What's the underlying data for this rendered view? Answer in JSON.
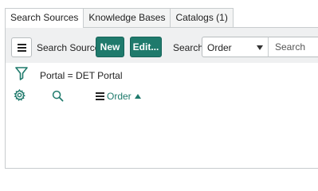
{
  "tabs": [
    {
      "label": "Search Sources",
      "active": true
    },
    {
      "label": "Knowledge Bases",
      "active": false
    },
    {
      "label": "Catalogs (1)",
      "active": false
    }
  ],
  "toolbar": {
    "title": "Search Sources",
    "new_label": "New",
    "edit_label": "Edit...",
    "search_label": "Search",
    "search_field_selected": "Order",
    "search_placeholder": "Search"
  },
  "filter": {
    "text": "Portal = DET Portal"
  },
  "list_header": {
    "sort_column": "Order",
    "sort_direction": "ascending"
  },
  "colors": {
    "accent": "#1f7a6c",
    "toolbar_bg": "#eff0f1",
    "border": "#c8ccce"
  }
}
